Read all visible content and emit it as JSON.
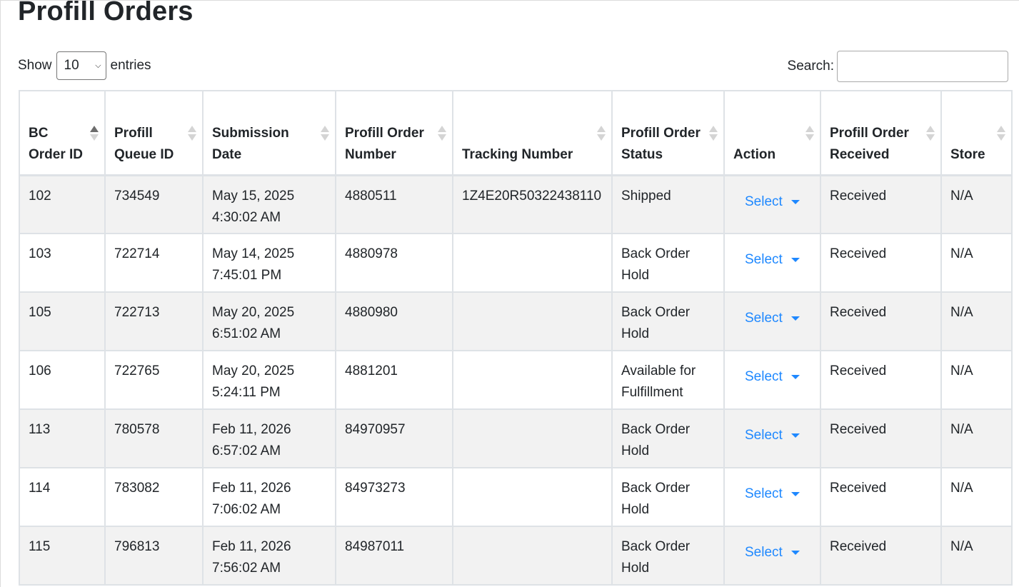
{
  "page": {
    "title": "Profill Orders"
  },
  "length": {
    "prefix": "Show",
    "value": "10",
    "suffix": "entries"
  },
  "search": {
    "label": "Search:",
    "value": ""
  },
  "table": {
    "columns": [
      {
        "label": "BC Order ID",
        "sort": "asc"
      },
      {
        "label": "Profill Queue ID",
        "sort": "none"
      },
      {
        "label": "Submission Date",
        "sort": "none"
      },
      {
        "label": "Profill Order Number",
        "sort": "none"
      },
      {
        "label": "Tracking Number",
        "sort": "none"
      },
      {
        "label": "Profill Order Status",
        "sort": "none"
      },
      {
        "label": "Action",
        "sort": "none"
      },
      {
        "label": "Profill Order Received",
        "sort": "none"
      },
      {
        "label": "Store",
        "sort": "none"
      }
    ],
    "rows": [
      {
        "bc_order_id": "102",
        "queue_id": "734549",
        "date": "May 15, 2025",
        "time": "4:30:02 AM",
        "order_number": "4880511",
        "tracking": "1Z4E20R50322438110",
        "status": "Shipped",
        "action": "Select",
        "received": "Received",
        "store": "N/A"
      },
      {
        "bc_order_id": "103",
        "queue_id": "722714",
        "date": "May 14, 2025",
        "time": "7:45:01 PM",
        "order_number": "4880978",
        "tracking": "",
        "status": "Back Order Hold",
        "action": "Select",
        "received": "Received",
        "store": "N/A"
      },
      {
        "bc_order_id": "105",
        "queue_id": "722713",
        "date": "May 20, 2025",
        "time": "6:51:02 AM",
        "order_number": "4880980",
        "tracking": "",
        "status": "Back Order Hold",
        "action": "Select",
        "received": "Received",
        "store": "N/A"
      },
      {
        "bc_order_id": "106",
        "queue_id": "722765",
        "date": "May 20, 2025",
        "time": "5:24:11 PM",
        "order_number": "4881201",
        "tracking": "",
        "status": "Available for Fulfillment",
        "action": "Select",
        "received": "Received",
        "store": "N/A"
      },
      {
        "bc_order_id": "113",
        "queue_id": "780578",
        "date": "Feb 11, 2026",
        "time": "6:57:02 AM",
        "order_number": "84970957",
        "tracking": "",
        "status": "Back Order Hold",
        "action": "Select",
        "received": "Received",
        "store": "N/A"
      },
      {
        "bc_order_id": "114",
        "queue_id": "783082",
        "date": "Feb 11, 2026",
        "time": "7:06:02 AM",
        "order_number": "84973273",
        "tracking": "",
        "status": "Back Order Hold",
        "action": "Select",
        "received": "Received",
        "store": "N/A"
      },
      {
        "bc_order_id": "115",
        "queue_id": "796813",
        "date": "Feb 11, 2026",
        "time": "7:56:02 AM",
        "order_number": "84987011",
        "tracking": "",
        "status": "Back Order Hold",
        "action": "Select",
        "received": "Received",
        "store": "N/A"
      }
    ]
  },
  "colors": {
    "link": "#1e88ff",
    "stripe": "#f2f2f2",
    "border": "#dee2e6"
  },
  "icons": {
    "sort": "sort-arrows-icon",
    "dropdown": "caret-down-icon",
    "select_chevron": "chevron-down-icon"
  }
}
